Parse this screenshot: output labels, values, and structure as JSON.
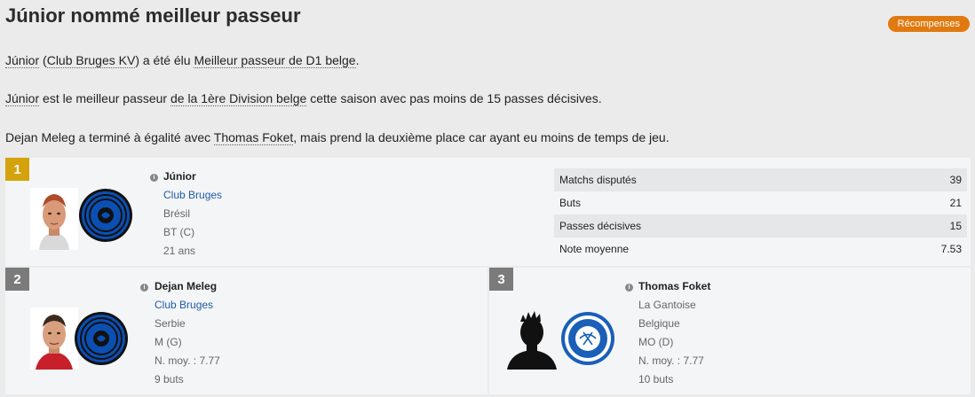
{
  "header": {
    "title": "Júnior nommé meilleur passeur",
    "badge": "Récompenses"
  },
  "paragraphs": {
    "p1": {
      "player": "Júnior",
      "open_paren": " (",
      "club": "Club Bruges KV",
      "mid": ") a été élu ",
      "award": "Meilleur passeur de D1 belge",
      "end": "."
    },
    "p2": {
      "player": "Júnior",
      "mid1": " est le meilleur passeur ",
      "league": "de la 1ère Division belge",
      "end": " cette saison avec pas moins de 15 passes décisives."
    },
    "p3": {
      "player1": "Dejan Meleg",
      "mid": " a terminé à égalité avec ",
      "player2": "Thomas Foket",
      "end": ", mais prend la deuxième place car ayant eu moins de temps de jeu."
    }
  },
  "first": {
    "rank": "1",
    "name": "Júnior",
    "club": "Club Bruges",
    "nation": "Brésil",
    "position": "BT (C)",
    "age": "21 ans",
    "stats": [
      {
        "label": "Matchs disputés",
        "value": "39"
      },
      {
        "label": "Buts",
        "value": "21"
      },
      {
        "label": "Passes décisives",
        "value": "15"
      },
      {
        "label": "Note moyenne",
        "value": "7.53"
      }
    ]
  },
  "second": {
    "rank": "2",
    "name": "Dejan Meleg",
    "club": "Club Bruges",
    "nation": "Serbie",
    "position": "M (G)",
    "rating": "N. moy. : 7.77",
    "goals": "9 buts"
  },
  "third": {
    "rank": "3",
    "name": "Thomas Foket",
    "club": "La Gantoise",
    "nation": "Belgique",
    "position": "MO (D)",
    "rating": "N. moy. : 7.77",
    "goals": "10 buts"
  },
  "colors": {
    "badge": "#e07a10",
    "gold": "#d4a20c",
    "grey_rank": "#7b7b7b",
    "club_link": "#1f5ba8",
    "bruges_crest": "#0b4fb3",
    "gent_crest": "#1a5fb8"
  }
}
